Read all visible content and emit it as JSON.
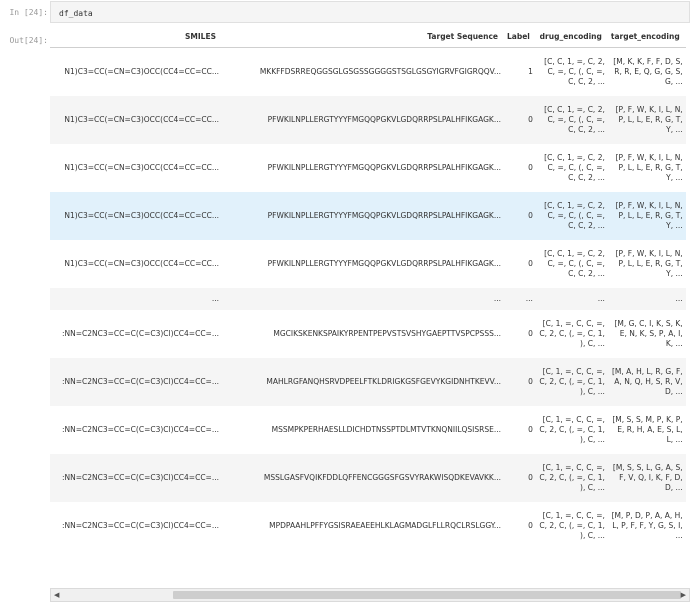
{
  "cell": {
    "in_prompt": "In [24]:",
    "code": "df_data",
    "out_prompt": "Out[24]:"
  },
  "table": {
    "headers": [
      "SMILES",
      "Target Sequence",
      "Label",
      "drug_encoding",
      "target_encoding"
    ],
    "rows": [
      {
        "smiles": "N1)C3=CC(=CN=C3)OCC(CC4=CC=CC...",
        "target": "MKKFFDSRREQGGSGLGSGSSGGGGSTSGLGSGYIGRVFGIGRQQV...",
        "label": "1",
        "drug": "[C, C, 1, =, C, 2, C, =, C, (, C, =, C, C, 2, ...",
        "tenc": "[M, K, K, F, F, D, S, R, R, E, Q, G, G, S, G, ..."
      },
      {
        "smiles": "N1)C3=CC(=CN=C3)OCC(CC4=CC=CC...",
        "target": "PFWKILNPLLERGTYYYFMGQQPGKVLGDQRRPSLPALHFIKGAGK...",
        "label": "0",
        "drug": "[C, C, 1, =, C, 2, C, =, C, (, C, =, C, C, 2, ...",
        "tenc": "[P, F, W, K, I, L, N, P, L, L, E, R, G, T, Y, ..."
      },
      {
        "smiles": "N1)C3=CC(=CN=C3)OCC(CC4=CC=CC...",
        "target": "PFWKILNPLLERGTYYYFMGQQPGKVLGDQRRPSLPALHFIKGAGK...",
        "label": "0",
        "drug": "[C, C, 1, =, C, 2, C, =, C, (, C, =, C, C, 2, ...",
        "tenc": "[P, F, W, K, I, L, N, P, L, L, E, R, G, T, Y, ..."
      },
      {
        "smiles": "N1)C3=CC(=CN=C3)OCC(CC4=CC=CC...",
        "target": "PFWKILNPLLERGTYYYFMGQQPGKVLGDQRRPSLPALHFIKGAGK...",
        "label": "0",
        "drug": "[C, C, 1, =, C, 2, C, =, C, (, C, =, C, C, 2, ...",
        "tenc": "[P, F, W, K, I, L, N, P, L, L, E, R, G, T, Y, ..."
      },
      {
        "smiles": "N1)C3=CC(=CN=C3)OCC(CC4=CC=CC...",
        "target": "PFWKILNPLLERGTYYYFMGQQPGKVLGDQRRPSLPALHFIKGAGK...",
        "label": "0",
        "drug": "[C, C, 1, =, C, 2, C, =, C, (, C, =, C, C, 2, ...",
        "tenc": "[P, F, W, K, I, L, N, P, L, L, E, R, G, T, Y, ..."
      },
      {
        "smiles": "...",
        "target": "...",
        "label": "...",
        "drug": "...",
        "tenc": "..."
      },
      {
        "smiles": ":NN=C2NC3=CC=C(C=C3)Cl)CC4=CC=...",
        "target": "MGCIKSKENKSPAIKYRPENTPEPVSTSVSHYGAEPTTVSPCPSSS...",
        "label": "0",
        "drug": "[C, 1, =, C, C, =, C, 2, C, (, =, C, 1, ), C, ...",
        "tenc": "[M, G, C, I, K, S, K, E, N, K, S, P, A, I, K, ..."
      },
      {
        "smiles": ":NN=C2NC3=CC=C(C=C3)Cl)CC4=CC=...",
        "target": "MAHLRGFANQHSRVDPEELFTKLDRIGKGSFGEVYKGIDNHTKEVV...",
        "label": "0",
        "drug": "[C, 1, =, C, C, =, C, 2, C, (, =, C, 1, ), C, ...",
        "tenc": "[M, A, H, L, R, G, F, A, N, Q, H, S, R, V, D, ..."
      },
      {
        "smiles": ":NN=C2NC3=CC=C(C=C3)Cl)CC4=CC=...",
        "target": "MSSMPKPERHAESLLDICHDTNSSPTDLMTVTKNQNIILQSISRSE...",
        "label": "0",
        "drug": "[C, 1, =, C, C, =, C, 2, C, (, =, C, 1, ), C, ...",
        "tenc": "[M, S, S, M, P, K, P, E, R, H, A, E, S, L, L, ..."
      },
      {
        "smiles": ":NN=C2NC3=CC=C(C=C3)Cl)CC4=CC=...",
        "target": "MSSLGASFVQIKFDDLQFFENCGGGSFGSVYRAKWISQDKEVAVKK...",
        "label": "0",
        "drug": "[C, 1, =, C, C, =, C, 2, C, (, =, C, 1, ), C, ...",
        "tenc": "[M, S, S, L, G, A, S, F, V, Q, I, K, F, D, D, ..."
      },
      {
        "smiles": ":NN=C2NC3=CC=C(C=C3)Cl)CC4=CC=...",
        "target": "MPDPAAHLPFFYGSISRAEAEEHLKLAGMADGLFLLRQCLRSLGGY...",
        "label": "0",
        "drug": "[C, 1, =, C, C, =, C, 2, C, (, =, C, 1, ), C, ...",
        "tenc": "[M, P, D, P, A, A, H, L, P, F, F, Y, G, S, I, ..."
      }
    ]
  },
  "scrollbar": {
    "left_arrow": "◀",
    "right_arrow": "▶"
  }
}
